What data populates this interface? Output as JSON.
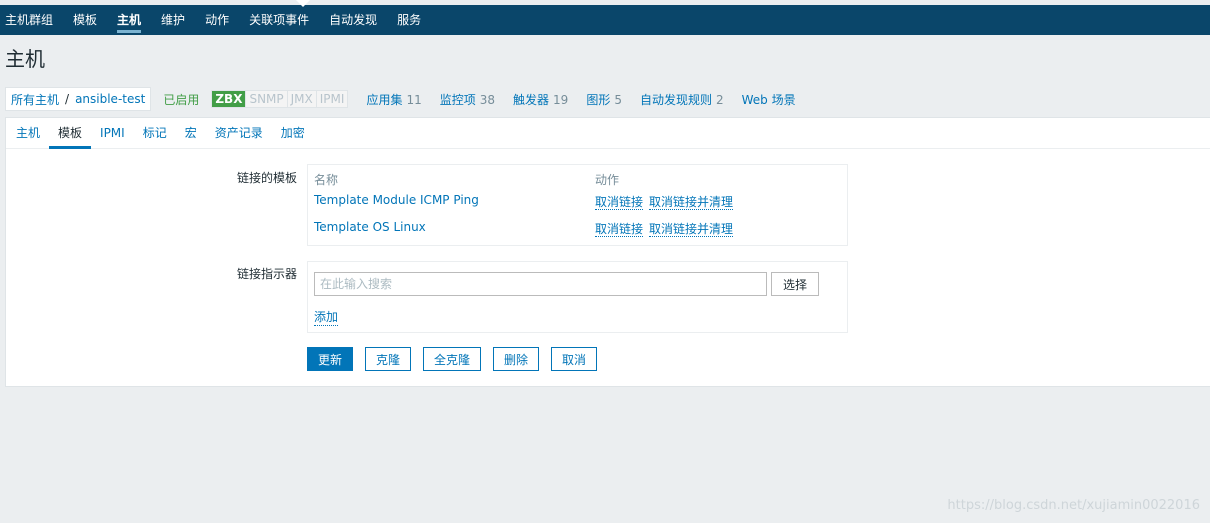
{
  "topnav": {
    "items": [
      "主机群组",
      "模板",
      "主机",
      "维护",
      "动作",
      "关联项事件",
      "自动发现",
      "服务"
    ],
    "active_index": 2
  },
  "page_title": "主机",
  "hostbar": {
    "all_hosts": "所有主机",
    "separator": "/",
    "host_name": "ansible-test",
    "status": "已启用",
    "availability": [
      "ZBX",
      "SNMP",
      "JMX",
      "IPMI"
    ],
    "links": [
      {
        "label": "应用集",
        "count": "11"
      },
      {
        "label": "监控项",
        "count": "38"
      },
      {
        "label": "触发器",
        "count": "19"
      },
      {
        "label": "图形",
        "count": "5"
      },
      {
        "label": "自动发现规则",
        "count": "2"
      },
      {
        "label": "Web 场景",
        "count": ""
      }
    ]
  },
  "tabs": [
    "主机",
    "模板",
    "IPMI",
    "标记",
    "宏",
    "资产记录",
    "加密"
  ],
  "active_tab": 1,
  "linked_templates": {
    "label": "链接的模板",
    "col_name": "名称",
    "col_action": "动作",
    "rows": [
      {
        "name": "Template Module ICMP Ping",
        "unlink": "取消链接",
        "unlink_clear": "取消链接并清理"
      },
      {
        "name": "Template OS Linux",
        "unlink": "取消链接",
        "unlink_clear": "取消链接并清理"
      }
    ]
  },
  "link_indicator": {
    "label": "链接指示器",
    "placeholder": "在此输入搜索",
    "value": "",
    "select_button": "选择",
    "add_link": "添加"
  },
  "buttons": {
    "update": "更新",
    "clone": "克隆",
    "full_clone": "全克隆",
    "delete": "删除",
    "cancel": "取消"
  },
  "watermark": "https://blog.csdn.net/xujiamin0022016",
  "colors": {
    "nav_bg": "#0a466a",
    "link": "#0275b8",
    "enabled_green": "#429e47"
  }
}
